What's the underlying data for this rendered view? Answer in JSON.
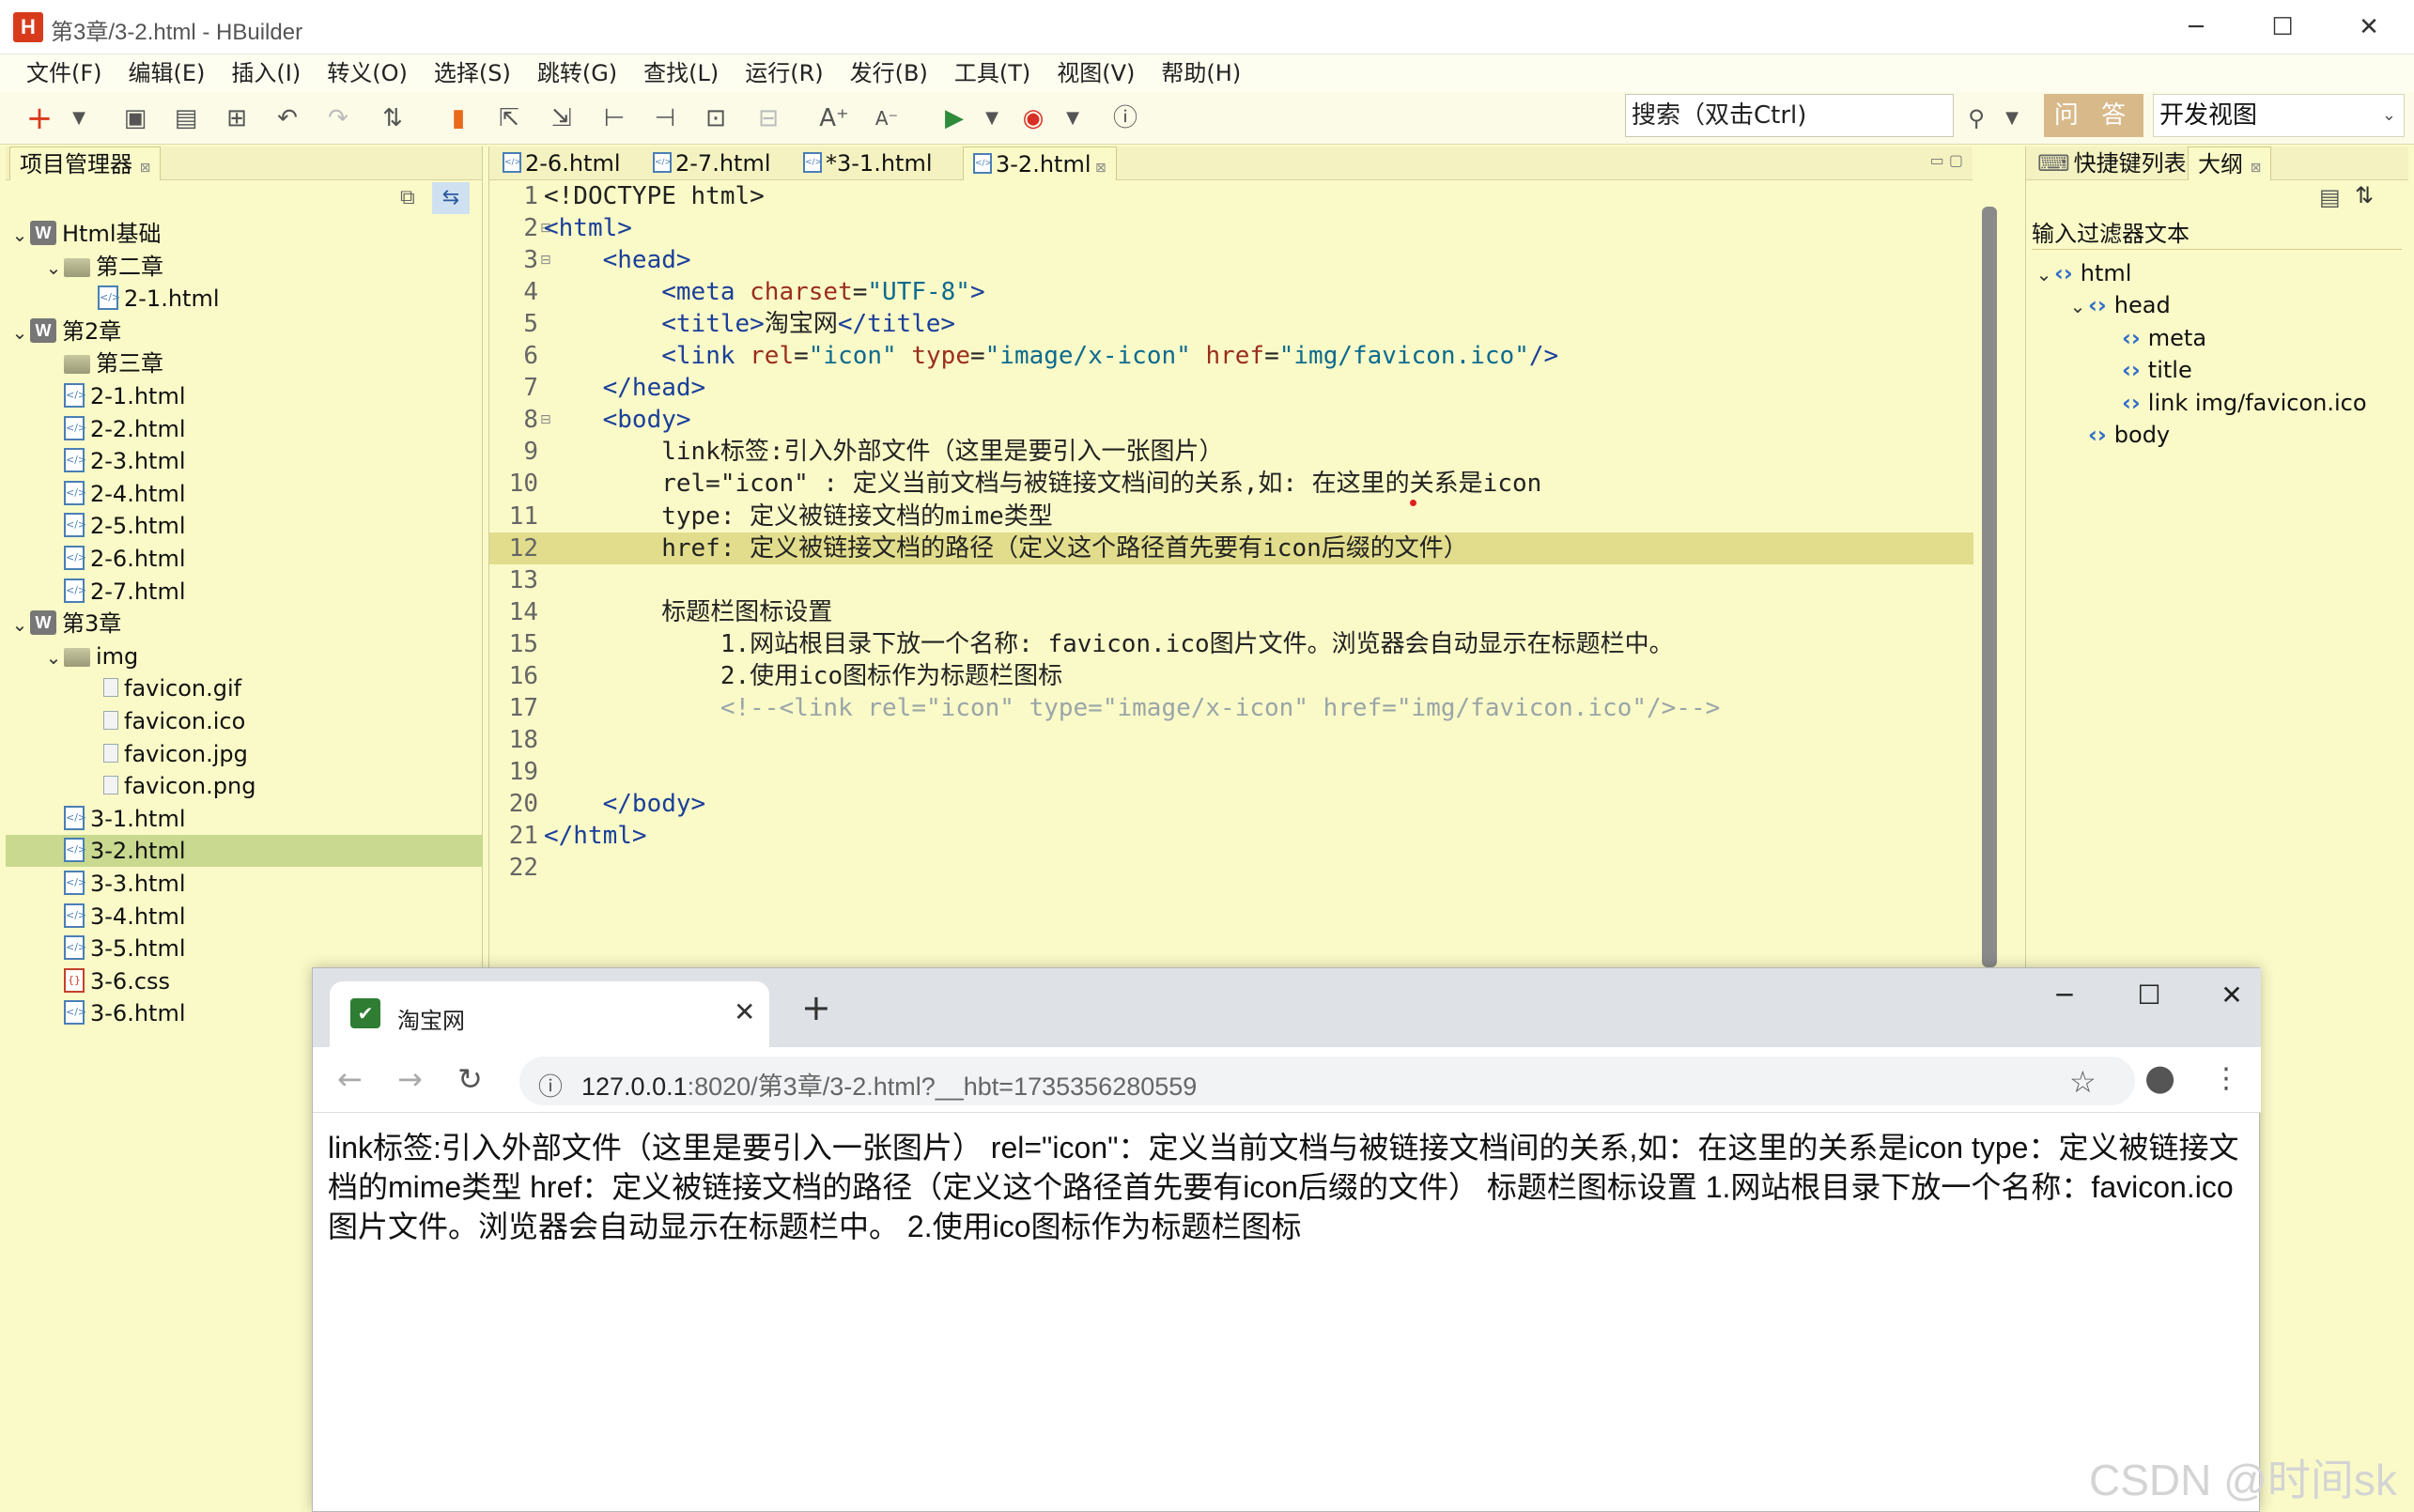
{
  "window": {
    "title": "第3章/3-2.html  -  HBuilder",
    "logo": "H"
  },
  "menu": [
    "文件(F)",
    "编辑(E)",
    "插入(I)",
    "转义(O)",
    "选择(S)",
    "跳转(G)",
    "查找(L)",
    "运行(R)",
    "发行(B)",
    "工具(T)",
    "视图(V)",
    "帮助(H)"
  ],
  "toolbar": {
    "search_placeholder": "搜索（双击Ctrl)",
    "ask_label": "问 答",
    "view_label": "开发视图"
  },
  "left_panel": {
    "tab": "项目管理器"
  },
  "tree": [
    {
      "label": "Html基础",
      "type": "project",
      "depth": 0,
      "arrow": "v"
    },
    {
      "label": "第二章",
      "type": "folder",
      "depth": 1,
      "arrow": "v"
    },
    {
      "label": "2-1.html",
      "type": "html",
      "depth": 2,
      "arrow": ""
    },
    {
      "label": "第2章",
      "type": "project",
      "depth": 0,
      "arrow": "v"
    },
    {
      "label": "第三章",
      "type": "folder",
      "depth": 1,
      "arrow": ""
    },
    {
      "label": "2-1.html",
      "type": "html",
      "depth": 1,
      "arrow": ""
    },
    {
      "label": "2-2.html",
      "type": "html",
      "depth": 1,
      "arrow": ""
    },
    {
      "label": "2-3.html",
      "type": "html",
      "depth": 1,
      "arrow": ""
    },
    {
      "label": "2-4.html",
      "type": "html",
      "depth": 1,
      "arrow": ""
    },
    {
      "label": "2-5.html",
      "type": "html",
      "depth": 1,
      "arrow": ""
    },
    {
      "label": "2-6.html",
      "type": "html",
      "depth": 1,
      "arrow": ""
    },
    {
      "label": "2-7.html",
      "type": "html",
      "depth": 1,
      "arrow": ""
    },
    {
      "label": "第3章",
      "type": "project",
      "depth": 0,
      "arrow": "v"
    },
    {
      "label": "img",
      "type": "folder",
      "depth": 1,
      "arrow": "v"
    },
    {
      "label": "favicon.gif",
      "type": "image",
      "depth": 2,
      "arrow": ""
    },
    {
      "label": "favicon.ico",
      "type": "image",
      "depth": 2,
      "arrow": ""
    },
    {
      "label": "favicon.jpg",
      "type": "image",
      "depth": 2,
      "arrow": ""
    },
    {
      "label": "favicon.png",
      "type": "image",
      "depth": 2,
      "arrow": ""
    },
    {
      "label": "3-1.html",
      "type": "html",
      "depth": 1,
      "arrow": ""
    },
    {
      "label": "3-2.html",
      "type": "html",
      "depth": 1,
      "arrow": "",
      "selected": true
    },
    {
      "label": "3-3.html",
      "type": "html",
      "depth": 1,
      "arrow": ""
    },
    {
      "label": "3-4.html",
      "type": "html",
      "depth": 1,
      "arrow": ""
    },
    {
      "label": "3-5.html",
      "type": "html",
      "depth": 1,
      "arrow": ""
    },
    {
      "label": "3-6.css",
      "type": "css",
      "depth": 1,
      "arrow": ""
    },
    {
      "label": "3-6.html",
      "type": "html",
      "depth": 1,
      "arrow": ""
    }
  ],
  "editor_tabs": [
    "2-6.html",
    "2-7.html",
    "*3-1.html",
    "3-2.html"
  ],
  "code": [
    {
      "n": "1",
      "segs": [
        [
          "t",
          "<!DOCTYPE html>"
        ]
      ]
    },
    {
      "n": "2",
      "fold": true,
      "segs": [
        [
          "g",
          "<html>"
        ]
      ]
    },
    {
      "n": "3",
      "fold": true,
      "segs": [
        [
          "t",
          "    "
        ],
        [
          "g",
          "<head>"
        ]
      ]
    },
    {
      "n": "4",
      "segs": [
        [
          "t",
          "        "
        ],
        [
          "g",
          "<meta "
        ],
        [
          "a",
          "charset"
        ],
        [
          "t",
          "="
        ],
        [
          "s",
          "\"UTF-8\""
        ],
        [
          "g",
          ">"
        ]
      ]
    },
    {
      "n": "5",
      "segs": [
        [
          "t",
          "        "
        ],
        [
          "g",
          "<title>"
        ],
        [
          "t",
          "淘宝网"
        ],
        [
          "g",
          "</title>"
        ]
      ]
    },
    {
      "n": "6",
      "segs": [
        [
          "t",
          "        "
        ],
        [
          "g",
          "<link "
        ],
        [
          "a",
          "rel"
        ],
        [
          "t",
          "="
        ],
        [
          "s",
          "\"icon\" "
        ],
        [
          "a",
          "type"
        ],
        [
          "t",
          "="
        ],
        [
          "s",
          "\"image/x-icon\" "
        ],
        [
          "a",
          "href"
        ],
        [
          "t",
          "="
        ],
        [
          "s",
          "\"img/favicon.ico\""
        ],
        [
          "g",
          "/>"
        ]
      ]
    },
    {
      "n": "7",
      "segs": [
        [
          "t",
          "    "
        ],
        [
          "g",
          "</head>"
        ]
      ]
    },
    {
      "n": "8",
      "fold": true,
      "segs": [
        [
          "t",
          "    "
        ],
        [
          "g",
          "<body>"
        ]
      ]
    },
    {
      "n": "9",
      "segs": [
        [
          "t",
          "        link标签:引入外部文件（这里是要引入一张图片）"
        ]
      ]
    },
    {
      "n": "10",
      "segs": [
        [
          "t",
          "        rel=\"icon\" : 定义当前文档与被链接文档间的关系,如: 在这里的关系是icon"
        ]
      ]
    },
    {
      "n": "11",
      "segs": [
        [
          "t",
          "        type: 定义被链接文档的mime类型"
        ]
      ]
    },
    {
      "n": "12",
      "hl": true,
      "segs": [
        [
          "t",
          "        href: 定义被链接文档的路径（定义这个路径首先要有icon后缀的文件）"
        ]
      ]
    },
    {
      "n": "13",
      "segs": []
    },
    {
      "n": "14",
      "segs": [
        [
          "t",
          "        标题栏图标设置"
        ]
      ]
    },
    {
      "n": "15",
      "segs": [
        [
          "t",
          "            1.网站根目录下放一个名称: favicon.ico图片文件。浏览器会自动显示在标题栏中。"
        ]
      ]
    },
    {
      "n": "16",
      "segs": [
        [
          "t",
          "            2.使用ico图标作为标题栏图标"
        ]
      ]
    },
    {
      "n": "17",
      "segs": [
        [
          "t",
          "            "
        ],
        [
          "c",
          "<!--<link rel=\"icon\" type=\"image/x-icon\" href=\"img/favicon.ico\"/>-->"
        ]
      ]
    },
    {
      "n": "18",
      "segs": []
    },
    {
      "n": "19",
      "segs": []
    },
    {
      "n": "20",
      "segs": [
        [
          "t",
          "    "
        ],
        [
          "g",
          "</body>"
        ]
      ]
    },
    {
      "n": "21",
      "segs": [
        [
          "g",
          "</html>"
        ]
      ]
    },
    {
      "n": "22",
      "segs": []
    }
  ],
  "right_panel": {
    "tabs": [
      "快捷键列表",
      "大纲"
    ],
    "filter_label": "输入过滤器文本"
  },
  "outline": [
    {
      "label": "html",
      "depth": 0,
      "arrow": "v"
    },
    {
      "label": "head",
      "depth": 1,
      "arrow": "v"
    },
    {
      "label": "meta",
      "depth": 2,
      "arrow": ""
    },
    {
      "label": "title",
      "depth": 2,
      "arrow": ""
    },
    {
      "label": "link img/favicon.ico",
      "depth": 2,
      "arrow": ""
    },
    {
      "label": "body",
      "depth": 1,
      "arrow": ""
    }
  ],
  "browser": {
    "tab_title": "淘宝网",
    "url_host": "127.0.0.1",
    "url_rest": ":8020/第3章/3-2.html?__hbt=1735356280559",
    "content": "link标签:引入外部文件（这里是要引入一张图片） rel=\"icon\"：定义当前文档与被链接文档间的关系,如：在这里的关系是icon type：定义被链接文档的mime类型 href：定义被链接文档的路径（定义这个路径首先要有icon后缀的文件） 标题栏图标设置 1.网站根目录下放一个名称：favicon.ico图片文件。浏览器会自动显示在标题栏中。 2.使用ico图标作为标题栏图标"
  },
  "watermark": "CSDN @时间sk"
}
